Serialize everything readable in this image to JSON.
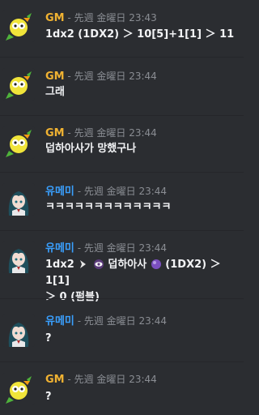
{
  "colors": {
    "gm": "#f0b232",
    "yumemi": "#3aa0ff",
    "background": "#2b2d31",
    "timestamp": "#8a8d93"
  },
  "messages": [
    {
      "author": "GM",
      "sep": " - ",
      "time": "先週 金曜日 23:43",
      "text": "1dx2 (1DX2) ＞ 10[5]+1[1] ＞ 11",
      "avatar": "gm-avatar"
    },
    {
      "author": "GM",
      "sep": " - ",
      "time": "先週 金曜日 23:44",
      "text": "그래",
      "avatar": "gm-avatar"
    },
    {
      "author": "GM",
      "sep": " - ",
      "time": "先週 金曜日 23:44",
      "text": "덥하아사가 망했구나",
      "avatar": "gm-avatar"
    },
    {
      "author": "유메미",
      "sep": " - ",
      "time": "先週 金曜日 23:44",
      "text": "ㅋㅋㅋㅋㅋㅋㅋㅋㅋㅋㅋㅋㅋ",
      "avatar": "yumemi-avatar"
    },
    {
      "author": "유메미",
      "sep": " - ",
      "time": "先週 金曜日 23:44",
      "text_parts": [
        "1dx2",
        "덥하아사",
        "(1DX2) ＞ 1[1]",
        "＞ 0 (펌블)"
      ],
      "avatar": "yumemi-avatar"
    },
    {
      "author": "유메미",
      "sep": " - ",
      "time": "先週 金曜日 23:44",
      "text": "?",
      "avatar": "yumemi-avatar"
    },
    {
      "author": "GM",
      "sep": " - ",
      "time": "先週 金曜日 23:44",
      "text": "?",
      "avatar": "gm-avatar"
    }
  ]
}
